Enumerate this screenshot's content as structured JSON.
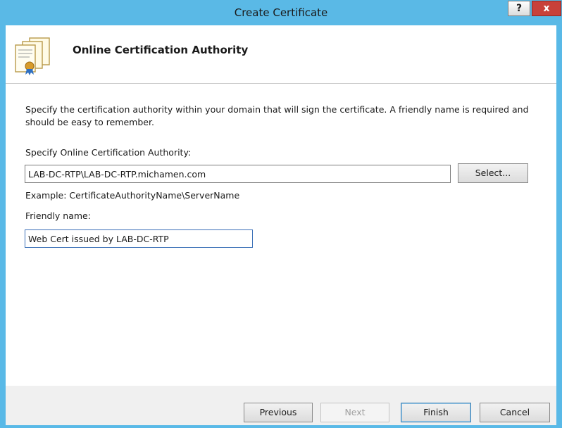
{
  "window": {
    "title": "Create Certificate",
    "help_label": "?",
    "close_label": "x"
  },
  "header": {
    "title": "Online Certification Authority"
  },
  "content": {
    "description": "Specify the certification authority within your domain that will sign the certificate. A friendly name is required and should be easy to remember.",
    "ca_label": "Specify Online Certification Authority:",
    "ca_value": "LAB-DC-RTP\\LAB-DC-RTP.michamen.com",
    "select_label": "Select...",
    "example": "Example: CertificateAuthorityName\\ServerName",
    "friendly_label": "Friendly name:",
    "friendly_value": "Web Cert issued by LAB-DC-RTP"
  },
  "footer": {
    "previous_label": "Previous",
    "next_label": "Next",
    "finish_label": "Finish",
    "cancel_label": "Cancel"
  },
  "colors": {
    "title_bar": "#5ab9e6",
    "close_button": "#c8413a"
  },
  "icons": {
    "header": "certificate-icon"
  }
}
